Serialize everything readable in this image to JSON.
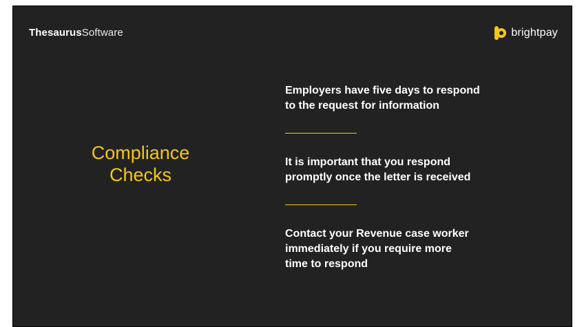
{
  "header": {
    "brand_bold": "Thesaurus",
    "brand_light": "Software",
    "logo_text": "brightpay"
  },
  "title": {
    "line1": "Compliance",
    "line2": "Checks"
  },
  "points": [
    {
      "line1": "Employers have five days to respond",
      "line2": "to the request for information"
    },
    {
      "line1": "It is important that you respond",
      "line2": "promptly once the letter is received"
    },
    {
      "line1": "Contact your Revenue case worker",
      "line2": "immediately if you require more",
      "line3": "time to respond"
    }
  ],
  "colors": {
    "background": "#222222",
    "accent": "#f5c518",
    "text": "#ffffff"
  },
  "icons": {
    "logo": "brightpay-logo-icon"
  }
}
